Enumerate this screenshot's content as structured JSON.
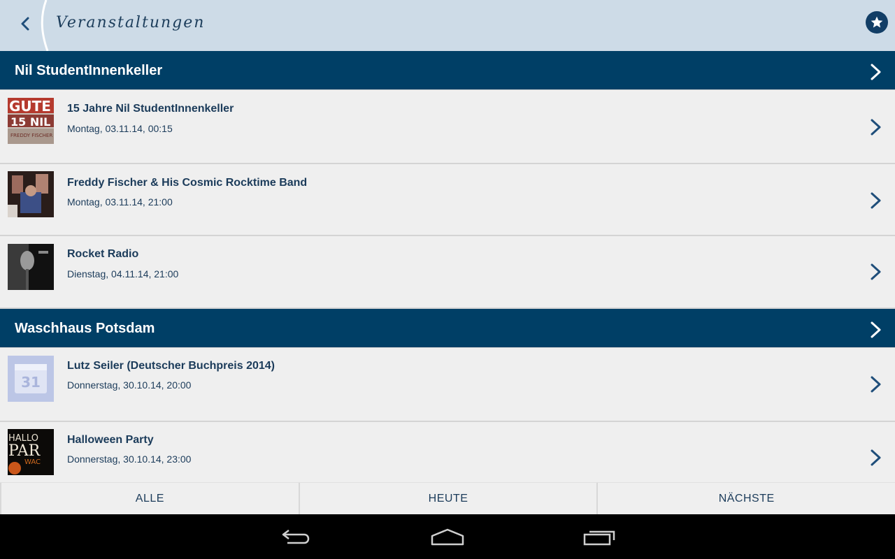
{
  "actionbar": {
    "title": "Veranstaltungen"
  },
  "sections": [
    {
      "title": "Nil StudentInnenkeller",
      "events": [
        {
          "title": "15 Jahre Nil StudentInnenkeller",
          "date": "Montag, 03.11.14, 00:15",
          "thumb": "poster-guete"
        },
        {
          "title": "Freddy Fischer & His Cosmic Rocktime Band",
          "date": "Montag, 03.11.14, 21:00",
          "thumb": "band-photo"
        },
        {
          "title": "Rocket Radio",
          "date": "Dienstag, 04.11.14, 21:00",
          "thumb": "microphone-photo"
        }
      ]
    },
    {
      "title": "Waschhaus Potsdam",
      "events": [
        {
          "title": "Lutz Seiler (Deutscher Buchpreis 2014)",
          "date": "Donnerstag, 30.10.14, 20:00",
          "thumb": "calendar-placeholder",
          "thumb_text": "31"
        },
        {
          "title": "Halloween Party",
          "date": "Donnerstag, 30.10.14, 23:00",
          "thumb": "halloween-poster",
          "thumb_text": "HALLO PAR WAC"
        }
      ]
    }
  ],
  "tabs": [
    "ALLE",
    "HEUTE",
    "NÄCHSTE"
  ],
  "colors": {
    "actionbar": "#cddbe7",
    "section_header": "#003f66",
    "text": "#1b3b5a",
    "background": "#efefef"
  }
}
